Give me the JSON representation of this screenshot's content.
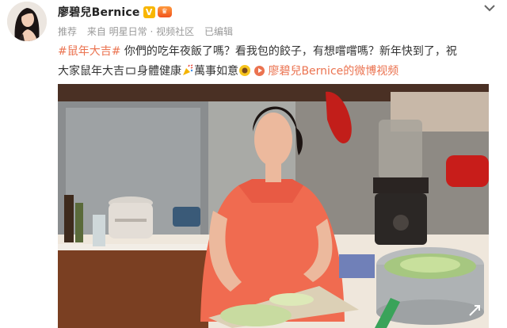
{
  "post": {
    "author": "廖碧兒Bernice",
    "verified_mark": "V",
    "meta": {
      "source_1": "推荐",
      "source_2": "来自 明星日常 · 视频社区",
      "edited": "已编辑"
    },
    "text": {
      "hashtag": "#鼠年大吉#",
      "line_a": " 你們的吃年夜飯了嗎？看我包的餃子，有想嚐嚐嗎？新年快到了，祝",
      "line_b": "大家鼠年大吉",
      "line_b2": "身體健康",
      "line_b3": "萬事如意",
      "video_link": "廖碧兒Bernice的微博视频"
    }
  },
  "colors": {
    "accent": "#eb7350",
    "muted": "#999999",
    "verified": "#f8b600"
  }
}
